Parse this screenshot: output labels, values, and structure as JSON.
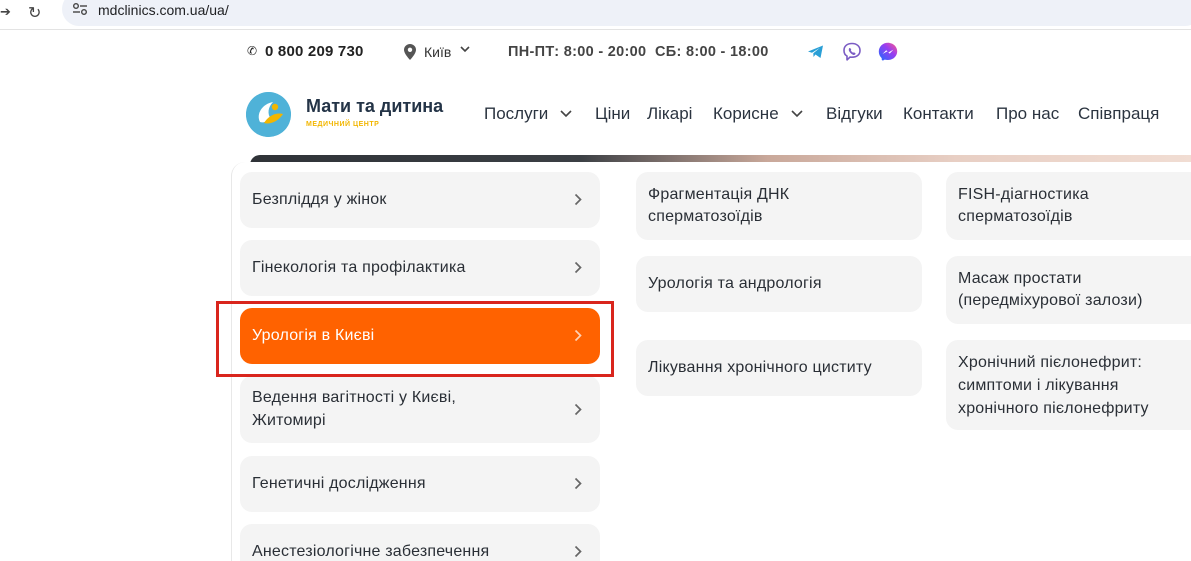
{
  "browser": {
    "url": "mdclinics.com.ua/ua/"
  },
  "topbar": {
    "phone": "0 800 209 730",
    "city": "Київ",
    "hours": "ПН-ПТ: 8:00 - 20:00  СБ: 8:00 - 18:00",
    "social_icons": [
      "telegram-icon",
      "viber-icon",
      "messenger-icon"
    ],
    "colors": {
      "telegram": "#2a9fd6",
      "viber": "#7b5cc4",
      "messenger": "#6b4cf0"
    }
  },
  "header": {
    "logo_title": "Мати та дитина",
    "logo_subtitle": "МЕДИЧНИЙ ЦЕНТР",
    "nav": [
      {
        "label": "Послуги",
        "dropdown": true
      },
      {
        "label": "Ціни"
      },
      {
        "label": "Лікарі"
      },
      {
        "label": "Корисне",
        "dropdown": true
      },
      {
        "label": "Відгуки"
      },
      {
        "label": "Контакти"
      },
      {
        "label": "Про нас"
      },
      {
        "label": "Співпраця"
      }
    ]
  },
  "menu": {
    "categories": [
      {
        "label": "Безпліддя у жінок"
      },
      {
        "label": "Гінекологія та профілактика"
      },
      {
        "label": "Урологія в Києві",
        "active": true
      },
      {
        "label": "Ведення вагітності у Києві,",
        "label2": "Житомирі"
      },
      {
        "label": "Генетичні дослідження"
      },
      {
        "label": "Анестезіологічне забезпечення"
      }
    ],
    "column2": [
      {
        "line1": "Фрагментація ДНК",
        "line2": "сперматозоїдів"
      },
      {
        "line1": "Урологія та андрологія"
      },
      {
        "line1": "Лікування хронічного циститу"
      }
    ],
    "column3": [
      {
        "line1": "FISH-діагностика",
        "line2": "сперматозоїдів"
      },
      {
        "line1": "Масаж простати",
        "line2": "(передміхурової залози)"
      },
      {
        "line1": "Хронічний пієлонефрит:",
        "line2": "симптоми і лікування",
        "line3": "хронічного пієлонефриту"
      }
    ],
    "accent_color": "#ff6200",
    "highlight_color": "#d9251d"
  }
}
